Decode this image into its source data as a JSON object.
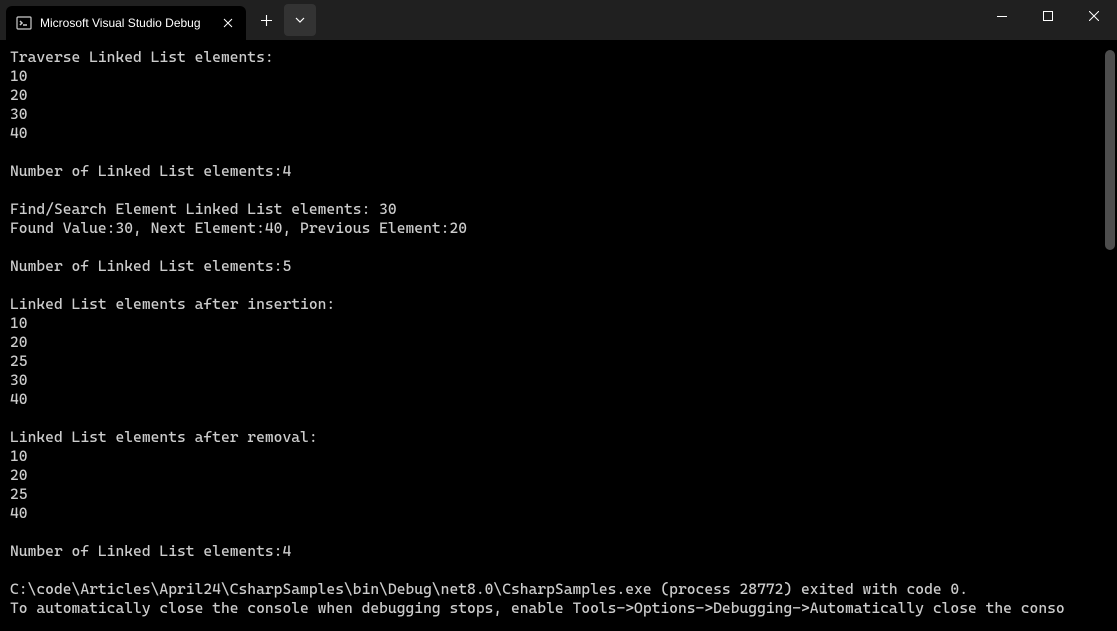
{
  "titlebar": {
    "tab_title": "Microsoft Visual Studio Debug",
    "tab_icon": "terminal-icon"
  },
  "console": {
    "lines": [
      "Traverse Linked List elements:",
      "10",
      "20",
      "30",
      "40",
      "",
      "Number of Linked List elements:4",
      "",
      "Find/Search Element Linked List elements: 30",
      "Found Value:30, Next Element:40, Previous Element:20",
      "",
      "Number of Linked List elements:5",
      "",
      "Linked List elements after insertion:",
      "10",
      "20",
      "25",
      "30",
      "40",
      "",
      "Linked List elements after removal:",
      "10",
      "20",
      "25",
      "40",
      "",
      "Number of Linked List elements:4",
      "",
      "C:\\code\\Articles\\April24\\CsharpSamples\\bin\\Debug\\net8.0\\CsharpSamples.exe (process 28772) exited with code 0.",
      "To automatically close the console when debugging stops, enable Tools->Options->Debugging->Automatically close the conso"
    ]
  }
}
